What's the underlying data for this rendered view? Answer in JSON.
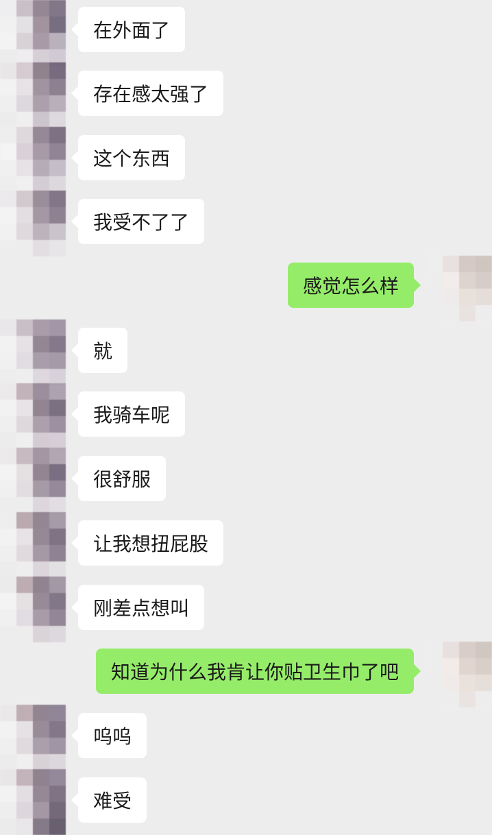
{
  "messages": [
    {
      "side": "in",
      "text": "在外面了"
    },
    {
      "side": "in",
      "text": "存在感太强了"
    },
    {
      "side": "in",
      "text": "这个东西"
    },
    {
      "side": "in",
      "text": "我受不了了"
    },
    {
      "side": "out",
      "text": "感觉怎么样"
    },
    {
      "side": "in",
      "text": "就"
    },
    {
      "side": "in",
      "text": "我骑车呢"
    },
    {
      "side": "in",
      "text": "很舒服"
    },
    {
      "side": "in",
      "text": "让我想扭屁股"
    },
    {
      "side": "in",
      "text": "刚差点想叫"
    },
    {
      "side": "out",
      "text": "知道为什么我肯让你贴卫生巾了吧"
    },
    {
      "side": "in",
      "text": "呜呜"
    },
    {
      "side": "in",
      "text": "难受"
    }
  ],
  "colors": {
    "background": "#ededed",
    "incoming_bubble": "#ffffff",
    "outgoing_bubble": "#95ec69",
    "text": "#1a1a1a"
  },
  "icons": {
    "contact_avatar": "pixelated-avatar-icon",
    "self_avatar": "pixelated-avatar-icon"
  }
}
